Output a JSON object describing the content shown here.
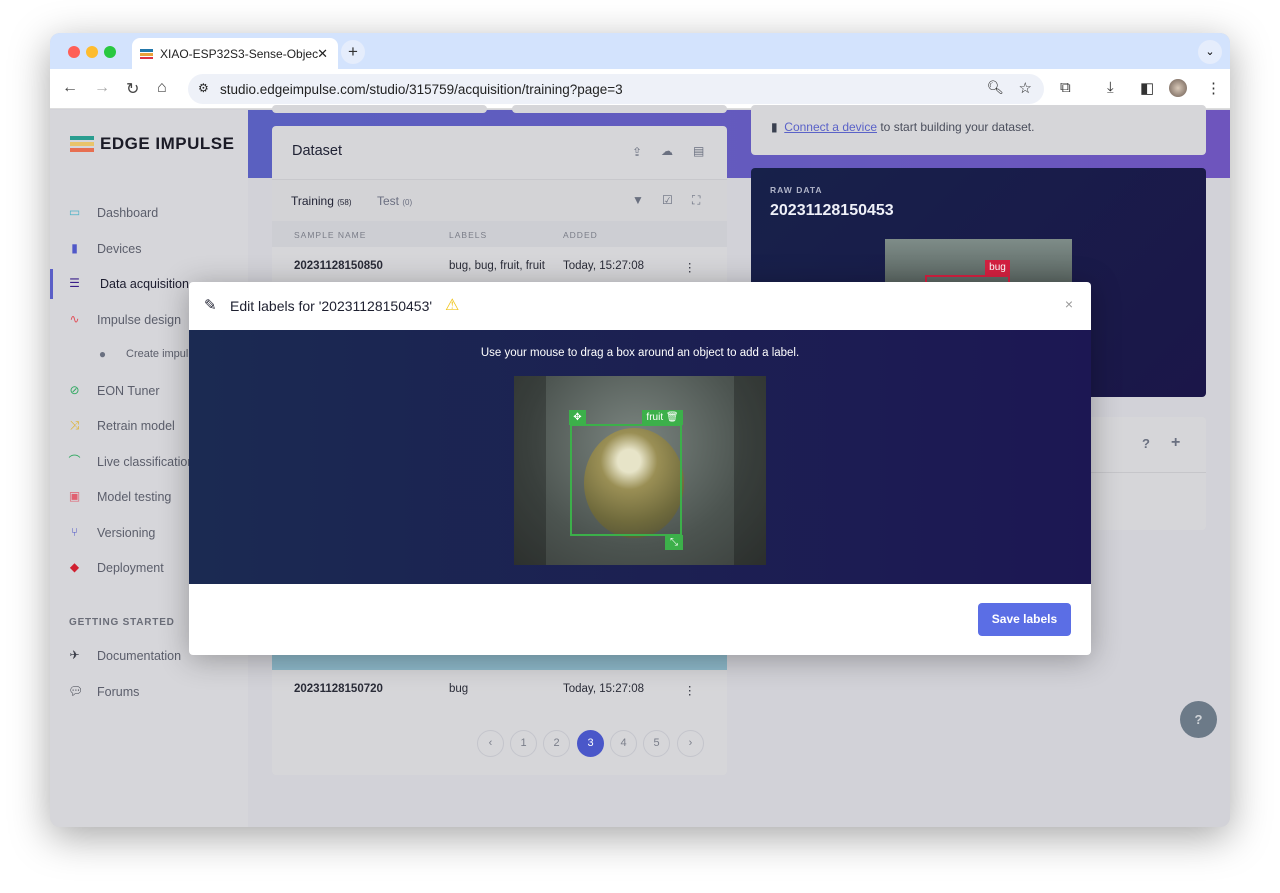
{
  "browser": {
    "tab_title": "XIAO-ESP32S3-Sense-Objec",
    "url": "studio.edgeimpulse.com/studio/315759/acquisition/training?page=3"
  },
  "sidebar": {
    "logo": "EDGE IMPULSE",
    "items": [
      {
        "label": "Dashboard",
        "icon": "monitor-icon",
        "color": "#4fb3c8"
      },
      {
        "label": "Devices",
        "icon": "chip-icon",
        "color": "#5058c8"
      },
      {
        "label": "Data acquisition",
        "icon": "database-icon",
        "color": "#3a1f8a"
      },
      {
        "label": "Impulse design",
        "icon": "pulse-icon",
        "color": "#e0505a"
      },
      {
        "label": "Create impul",
        "icon": "dot-icon",
        "color": "#6a7080"
      },
      {
        "label": "EON Tuner",
        "icon": "compass-icon",
        "color": "#2fa860"
      },
      {
        "label": "Retrain model",
        "icon": "shuffle-icon",
        "color": "#e0b020"
      },
      {
        "label": "Live classification",
        "icon": "network-icon",
        "color": "#2fa860"
      },
      {
        "label": "Model testing",
        "icon": "clipboard-icon",
        "color": "#e06070"
      },
      {
        "label": "Versioning",
        "icon": "branch-icon",
        "color": "#5058c8"
      },
      {
        "label": "Deployment",
        "icon": "cube-icon",
        "color": "#d02030"
      }
    ],
    "section": "GETTING STARTED",
    "help_items": [
      {
        "label": "Documentation",
        "icon": "rocket-icon"
      },
      {
        "label": "Forums",
        "icon": "chat-icon"
      }
    ]
  },
  "dataset": {
    "title": "Dataset",
    "tab_training": "Training",
    "training_count": "(58)",
    "tab_test": "Test",
    "test_count": "(0)",
    "columns": [
      "SAMPLE NAME",
      "LABELS",
      "ADDED"
    ],
    "rows": [
      {
        "name": "20231128150850",
        "labels": "bug, bug, fruit, fruit",
        "added": "Today, 15:27:08"
      },
      {
        "name": "20231128150720",
        "labels": "bug",
        "added": "Today, 15:27:08"
      }
    ],
    "pages": [
      "1",
      "2",
      "3",
      "4",
      "5"
    ],
    "current_page": "3"
  },
  "connect": {
    "link": "Connect a device",
    "text": " to start building your dataset."
  },
  "raw": {
    "label": "RAW DATA",
    "name": "20231128150453",
    "box_label": "bug"
  },
  "modal": {
    "title": "Edit labels for '20231128150453'",
    "instruction": "Use your mouse to drag a box around an object to add a label.",
    "box_label": "fruit",
    "save": "Save labels",
    "close": "×"
  }
}
